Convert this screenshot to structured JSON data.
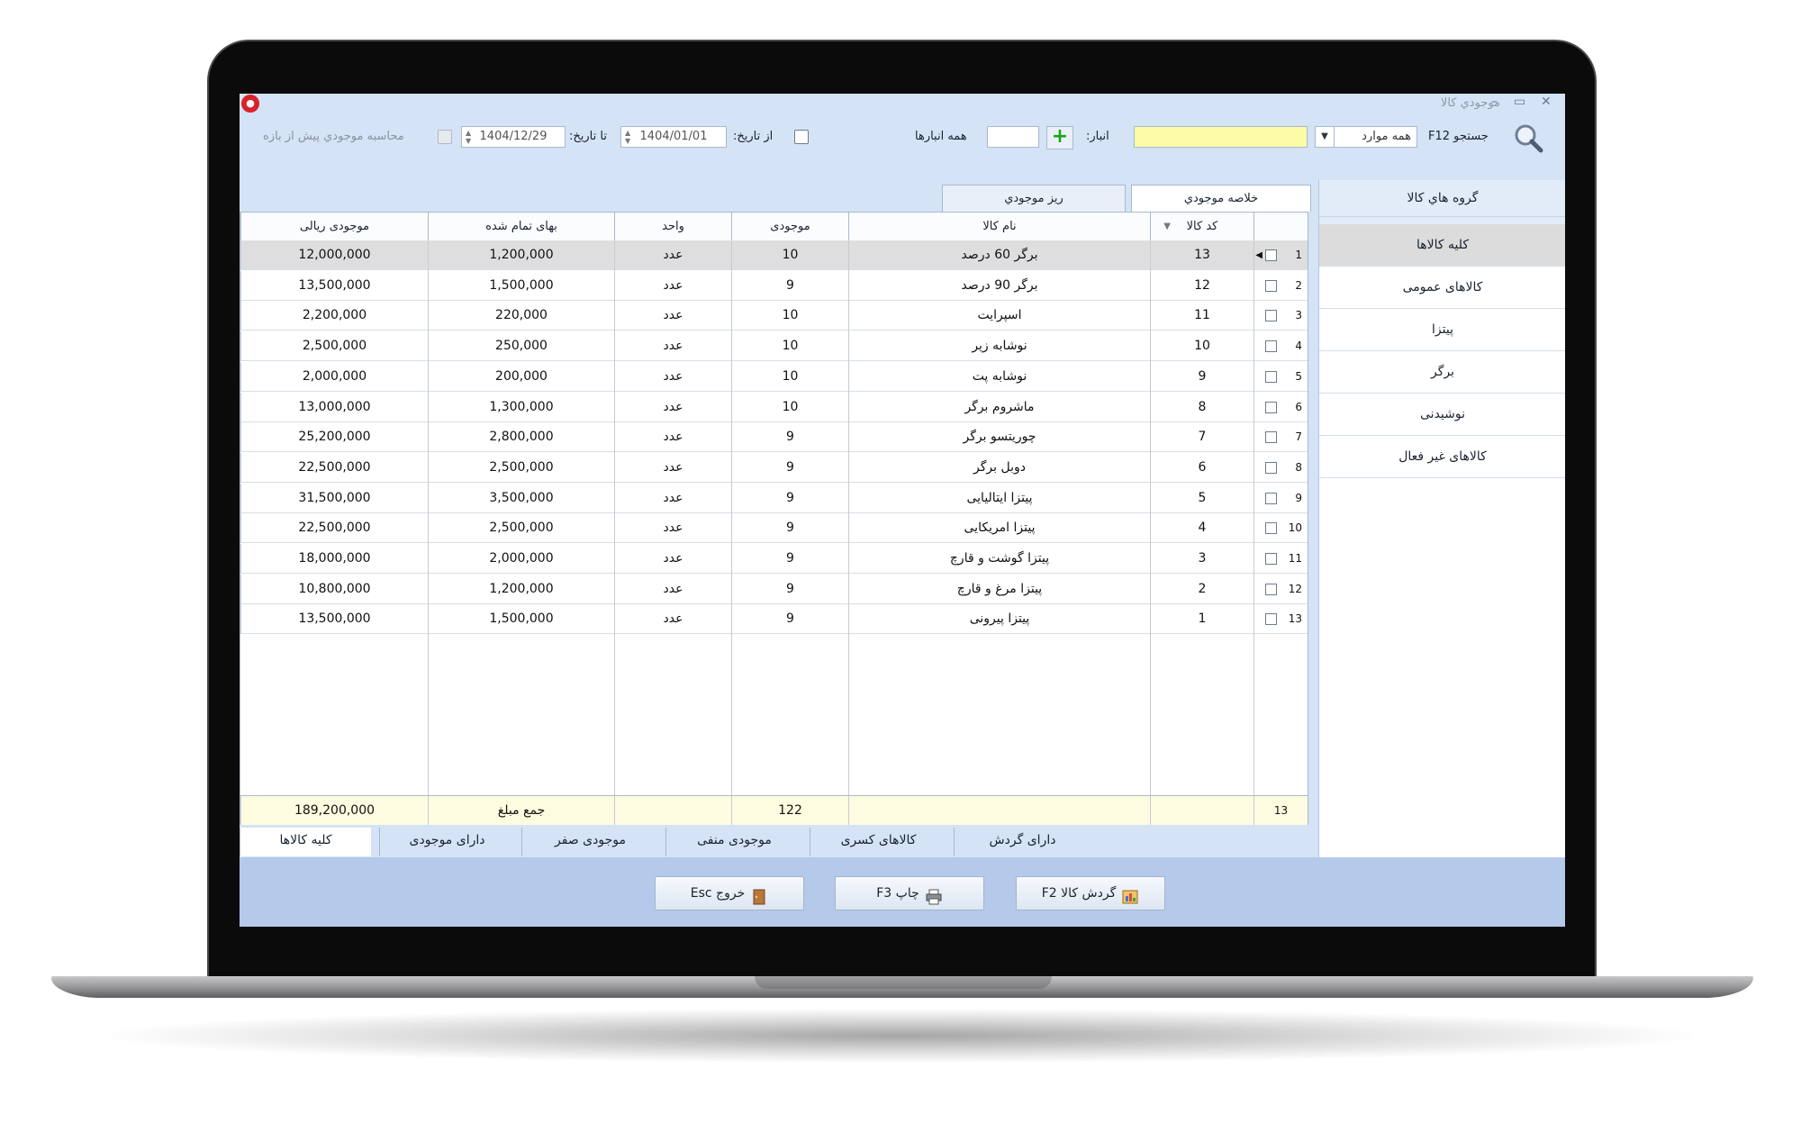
{
  "window": {
    "title": "موجودي كالا",
    "minimize": "–",
    "maximize": "▭",
    "close": "✕"
  },
  "toolbar": {
    "search_label": "جستجو F12",
    "filter_value": "همه موارد",
    "search_value": "",
    "warehouse_label": "انبار:",
    "warehouse_value": "",
    "all_warehouses": "همه انبارها",
    "from_date_label": "از تاریخ:",
    "from_date": "1404/01/01",
    "to_date_label": "تا تاریخ:",
    "to_date": "1404/12/29",
    "calc_before_label": "محاسبه موجودي پيش از بازه"
  },
  "groups": {
    "title": "گروه هاي كالا",
    "items": [
      "کلیه کالاها",
      "کالاهای عمومی",
      "پیتزا",
      "برگر",
      "نوشیدنی",
      "کالاهای غیر فعال"
    ],
    "selected_index": 0
  },
  "tabs_top": [
    "خلاصه موجودي",
    "ريز موجودي"
  ],
  "columns": [
    "کد کالا",
    "نام کالا",
    "موجودی",
    "واحد",
    "بهای تمام شده",
    "موجودی ریالی"
  ],
  "rows": [
    {
      "n": "1",
      "code": "13",
      "name": "برگر 60 درصد",
      "qty": "10",
      "unit": "عدد",
      "price": "1,200,000",
      "total": "12,000,000"
    },
    {
      "n": "2",
      "code": "12",
      "name": "برگر 90 درصد",
      "qty": "9",
      "unit": "عدد",
      "price": "1,500,000",
      "total": "13,500,000"
    },
    {
      "n": "3",
      "code": "11",
      "name": "اسپرایت",
      "qty": "10",
      "unit": "عدد",
      "price": "220,000",
      "total": "2,200,000"
    },
    {
      "n": "4",
      "code": "10",
      "name": "نوشابه زیر",
      "qty": "10",
      "unit": "عدد",
      "price": "250,000",
      "total": "2,500,000"
    },
    {
      "n": "5",
      "code": "9",
      "name": "نوشابه پت",
      "qty": "10",
      "unit": "عدد",
      "price": "200,000",
      "total": "2,000,000"
    },
    {
      "n": "6",
      "code": "8",
      "name": "ماشروم برگر",
      "qty": "10",
      "unit": "عدد",
      "price": "1,300,000",
      "total": "13,000,000"
    },
    {
      "n": "7",
      "code": "7",
      "name": "چوریتسو برگر",
      "qty": "9",
      "unit": "عدد",
      "price": "2,800,000",
      "total": "25,200,000"
    },
    {
      "n": "8",
      "code": "6",
      "name": "دوبل برگر",
      "qty": "9",
      "unit": "عدد",
      "price": "2,500,000",
      "total": "22,500,000"
    },
    {
      "n": "9",
      "code": "5",
      "name": "پیتزا ایتالیایی",
      "qty": "9",
      "unit": "عدد",
      "price": "3,500,000",
      "total": "31,500,000"
    },
    {
      "n": "10",
      "code": "4",
      "name": "پیتزا امریکایی",
      "qty": "9",
      "unit": "عدد",
      "price": "2,500,000",
      "total": "22,500,000"
    },
    {
      "n": "11",
      "code": "3",
      "name": "پیتزا گوشت و قارچ",
      "qty": "9",
      "unit": "عدد",
      "price": "2,000,000",
      "total": "18,000,000"
    },
    {
      "n": "12",
      "code": "2",
      "name": "پیتزا مرغ و قارچ",
      "qty": "9",
      "unit": "عدد",
      "price": "1,200,000",
      "total": "10,800,000"
    },
    {
      "n": "13",
      "code": "1",
      "name": "پیتزا پیرونی",
      "qty": "9",
      "unit": "عدد",
      "price": "1,500,000",
      "total": "13,500,000"
    }
  ],
  "footer": {
    "count": "13",
    "qty_sum": "122",
    "sum_label": "جمع مبلغ",
    "total_sum": "189,200,000"
  },
  "tabs_bottom": [
    "کلیه کالاها",
    "دارای موجودی",
    "موجودی صفر",
    "موجودی منفی",
    "کالاهای کسری",
    "دارای گردش"
  ],
  "buttons": {
    "exit": "خروج Esc",
    "print": "چاپ F3",
    "turnover": "گردش کالا F2"
  },
  "colors": {
    "screen_bg": "#d4e3f5",
    "button_bar": "#b5c9ea",
    "search_highlight": "#fdfca6",
    "footer": "#fdfbe0"
  }
}
